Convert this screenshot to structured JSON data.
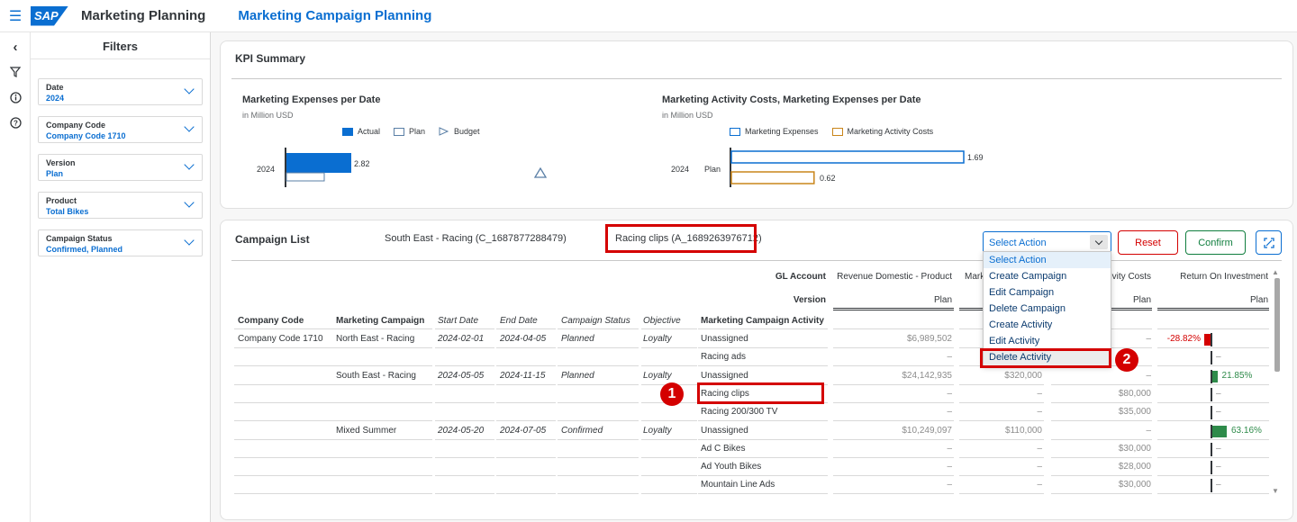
{
  "shell": {
    "app_title": "Marketing Planning",
    "page_title": "Marketing Campaign Planning",
    "logo_text": "SAP",
    "menu_icon": "hamburger-icon"
  },
  "rail": [
    "collapse-icon",
    "filter-icon",
    "info-icon",
    "help-icon"
  ],
  "filters": {
    "title": "Filters",
    "items": [
      {
        "label": "Date",
        "value": "2024"
      },
      {
        "label": "Company Code",
        "value": "Company Code 1710"
      },
      {
        "label": "Version",
        "value": "Plan"
      },
      {
        "label": "Product",
        "value": "Total Bikes"
      },
      {
        "label": "Campaign Status",
        "value": "Confirmed, Planned"
      }
    ]
  },
  "kpi": {
    "title": "KPI Summary",
    "chart1": {
      "title": "Marketing Expenses per Date",
      "subtitle": "in Million USD",
      "legend": [
        "Actual",
        "Plan",
        "Budget"
      ],
      "category": "2024",
      "actual": 2.82,
      "actual_label": "2.82",
      "plan": 1.69
    },
    "chart2": {
      "title": "Marketing Activity Costs, Marketing Expenses per Date",
      "subtitle": "in Million USD",
      "legend": [
        "Marketing Expenses",
        "Marketing Activity Costs"
      ],
      "category": "2024",
      "subcategory": "Plan",
      "expenses": 1.69,
      "expenses_label": "1.69",
      "activity_costs": 0.62,
      "activity_costs_label": "0.62"
    }
  },
  "chart_data": [
    {
      "type": "bar",
      "title": "Marketing Expenses per Date",
      "subtitle": "in Million USD",
      "categories": [
        "2024"
      ],
      "series": [
        {
          "name": "Actual",
          "values": [
            2.82
          ]
        },
        {
          "name": "Plan",
          "values": [
            1.2
          ]
        },
        {
          "name": "Budget",
          "values": []
        }
      ]
    },
    {
      "type": "bar",
      "title": "Marketing Activity Costs, Marketing Expenses per Date",
      "subtitle": "in Million USD",
      "categories": [
        "2024 Plan"
      ],
      "series": [
        {
          "name": "Marketing Expenses",
          "values": [
            1.69
          ]
        },
        {
          "name": "Marketing Activity Costs",
          "values": [
            0.62
          ]
        }
      ]
    }
  ],
  "campaign": {
    "title": "Campaign List",
    "selected_campaign": "South East - Racing (C_1687877288479)",
    "selected_activity": "Racing clips (A_1689263976712)",
    "select_value": "Select Action",
    "reset_label": "Reset",
    "confirm_label": "Confirm",
    "actions": [
      "Select Action",
      "Create Campaign",
      "Edit Campaign",
      "Delete Campaign",
      "Create Activity",
      "Edit Activity",
      "Delete Activity"
    ],
    "gl_account_label": "GL Account",
    "version_label": "Version",
    "gl_columns": [
      "Revenue Domestic - Product",
      "Mark",
      "ivity Costs",
      "Return On Investment"
    ],
    "version_values": [
      "Plan",
      "",
      "Plan",
      "Plan"
    ],
    "columns": [
      "Company Code",
      "Marketing Campaign",
      "Start Date",
      "End Date",
      "Campaign Status",
      "Objective",
      "Marketing Campaign Activity"
    ],
    "rows": [
      {
        "company": "Company Code 1710",
        "campaign": "North East - Racing",
        "start": "2024-02-01",
        "end": "2024-04-05",
        "status": "Planned",
        "objective": "Loyalty",
        "activity": "Unassigned",
        "rev": "$6,989,502",
        "mark": "",
        "cost": "–",
        "roi": "-28.82%",
        "roi_value": -28.82
      },
      {
        "company": "",
        "campaign": "",
        "start": "",
        "end": "",
        "status": "",
        "objective": "",
        "activity": "Racing ads",
        "rev": "–",
        "mark": "",
        "cost": "",
        "roi": "–",
        "roi_value": null
      },
      {
        "company": "",
        "campaign": "South East - Racing",
        "start": "2024-05-05",
        "end": "2024-11-15",
        "status": "Planned",
        "objective": "Loyalty",
        "activity": "Unassigned",
        "rev": "$24,142,935",
        "mark": "$320,000",
        "cost": "–",
        "roi": "21.85%",
        "roi_value": 21.85
      },
      {
        "company": "",
        "campaign": "",
        "start": "",
        "end": "",
        "status": "",
        "objective": "",
        "activity": "Racing clips",
        "rev": "–",
        "mark": "–",
        "cost": "$80,000",
        "roi": "–",
        "roi_value": null
      },
      {
        "company": "",
        "campaign": "",
        "start": "",
        "end": "",
        "status": "",
        "objective": "",
        "activity": "Racing 200/300 TV",
        "rev": "–",
        "mark": "–",
        "cost": "$35,000",
        "roi": "–",
        "roi_value": null
      },
      {
        "company": "",
        "campaign": "Mixed Summer",
        "start": "2024-05-20",
        "end": "2024-07-05",
        "status": "Confirmed",
        "objective": "Loyalty",
        "activity": "Unassigned",
        "rev": "$10,249,097",
        "mark": "$110,000",
        "cost": "–",
        "roi": "63.16%",
        "roi_value": 63.16
      },
      {
        "company": "",
        "campaign": "",
        "start": "",
        "end": "",
        "status": "",
        "objective": "",
        "activity": "Ad C Bikes",
        "rev": "–",
        "mark": "–",
        "cost": "$30,000",
        "roi": "–",
        "roi_value": null
      },
      {
        "company": "",
        "campaign": "",
        "start": "",
        "end": "",
        "status": "",
        "objective": "",
        "activity": "Ad Youth Bikes",
        "rev": "–",
        "mark": "–",
        "cost": "$28,000",
        "roi": "–",
        "roi_value": null
      },
      {
        "company": "",
        "campaign": "",
        "start": "",
        "end": "",
        "status": "",
        "objective": "",
        "activity": "Mountain Line Ads",
        "rev": "–",
        "mark": "–",
        "cost": "$30,000",
        "roi": "–",
        "roi_value": null
      }
    ],
    "badges": [
      "1",
      "2"
    ]
  },
  "colors": {
    "accent": "#0a6ed1",
    "alert": "#d40000",
    "positive": "#2e8b4a",
    "budget": "#0a6ed1",
    "activity_costs": "#c9851a"
  }
}
